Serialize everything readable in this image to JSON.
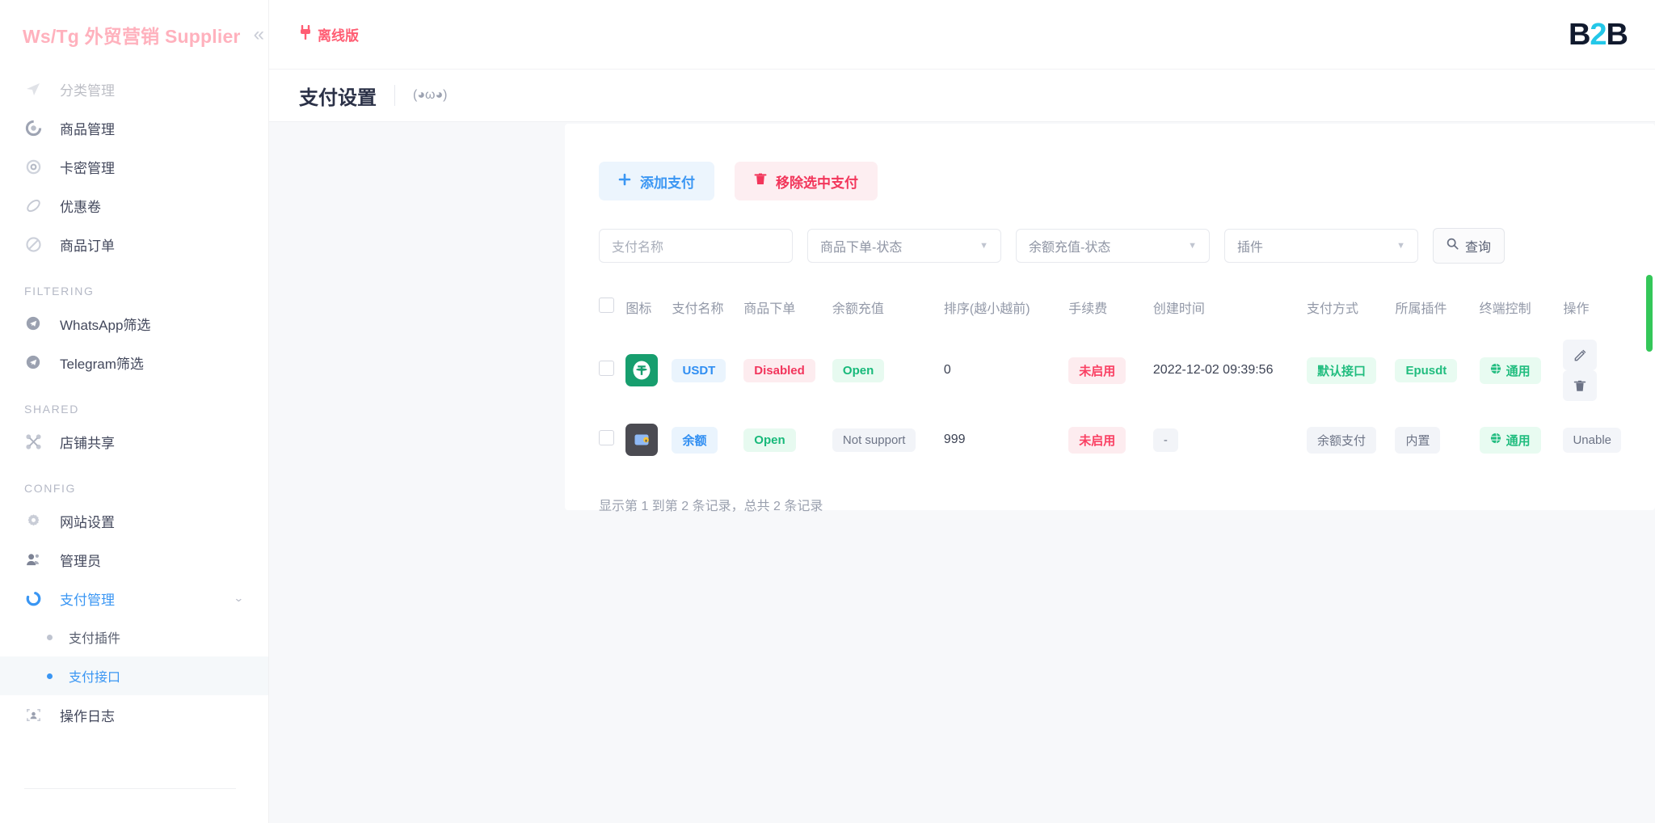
{
  "brand": {
    "title": "Ws/Tg 外贸营销 Supplier",
    "collapse_icon": "«"
  },
  "sidebar": {
    "items_top": [
      {
        "label": "分类管理",
        "icon": "send-icon",
        "cut": true
      },
      {
        "label": "商品管理",
        "icon": "circle-refresh-icon"
      },
      {
        "label": "卡密管理",
        "icon": "gear-dot-icon"
      },
      {
        "label": "优惠卷",
        "icon": "ticket-icon"
      },
      {
        "label": "商品订单",
        "icon": "forbidden-icon"
      }
    ],
    "group_filtering": "FILTERING",
    "items_filtering": [
      {
        "label": "WhatsApp筛选",
        "icon": "telegram-icon"
      },
      {
        "label": "Telegram筛选",
        "icon": "telegram-icon"
      }
    ],
    "group_shared": "SHARED",
    "items_shared": [
      {
        "label": "店铺共享",
        "icon": "share-nodes-icon"
      }
    ],
    "group_config": "CONFIG",
    "items_config": [
      {
        "label": "网站设置",
        "icon": "gear-icon"
      },
      {
        "label": "管理员",
        "icon": "users-icon"
      }
    ],
    "payment_menu": {
      "label": "支付管理",
      "icon": "loading-circle-icon",
      "chevron": "⌄"
    },
    "payment_subitems": [
      {
        "label": "支付插件",
        "selected": false
      },
      {
        "label": "支付接口",
        "selected": true
      }
    ],
    "items_tail": [
      {
        "label": "操作日志",
        "icon": "face-scan-icon"
      }
    ]
  },
  "topbar": {
    "offline_label": "离线版",
    "offline_icon": "plug-icon",
    "logo_b": "B",
    "logo_2": "2",
    "logo_b2": "B"
  },
  "pagehead": {
    "title": "支付设置",
    "subtitle": "(◕ω◕)"
  },
  "toolbar": {
    "add_label": "添加支付",
    "add_icon": "plus-icon",
    "delete_label": "移除选中支付",
    "delete_icon": "trash-icon"
  },
  "filters": {
    "name_placeholder": "支付名称",
    "select_order_status": "商品下单-状态",
    "select_recharge_status": "余额充值-状态",
    "select_plugin": "插件",
    "search_label": "查询",
    "search_icon": "search-icon"
  },
  "table": {
    "headers": [
      "",
      "图标",
      "支付名称",
      "商品下单",
      "余额充值",
      "排序(越小越前)",
      "手续费",
      "创建时间",
      "支付方式",
      "所属插件",
      "终端控制",
      "操作"
    ],
    "rows": [
      {
        "checked": false,
        "icon": "usdt-tether-icon",
        "name": "USDT",
        "order_status": "Disabled",
        "order_status_tone": "red",
        "recharge_status": "Open",
        "recharge_status_tone": "green",
        "sort": "0",
        "fee": "未启用",
        "fee_tone": "red",
        "created": "2022-12-02 09:39:56",
        "pay_method": "默认接口",
        "pay_method_tone": "green",
        "plugin": "Epusdt",
        "plugin_tone": "green",
        "terminal": "通用",
        "terminal_icon": "globe-icon",
        "actions": [
          "edit-icon",
          "trash-icon"
        ],
        "action_text": ""
      },
      {
        "checked": false,
        "icon": "wallet-icon",
        "name": "余额",
        "order_status": "Open",
        "order_status_tone": "green",
        "recharge_status": "Not support",
        "recharge_status_tone": "grey",
        "sort": "999",
        "fee": "未启用",
        "fee_tone": "red",
        "created": "-",
        "pay_method": "余额支付",
        "pay_method_tone": "grey",
        "plugin": "内置",
        "plugin_tone": "grey",
        "terminal": "通用",
        "terminal_icon": "globe-icon",
        "actions": [],
        "action_text": "Unable"
      }
    ],
    "footnote": "显示第 1 到第 2 条记录，总共 2 条记录"
  },
  "colors": {
    "brand_pink": "#ffb1bd",
    "accent_blue": "#3a96f3",
    "danger": "#f2365b",
    "success": "#17b97a",
    "scrollbar": "#34c759"
  }
}
